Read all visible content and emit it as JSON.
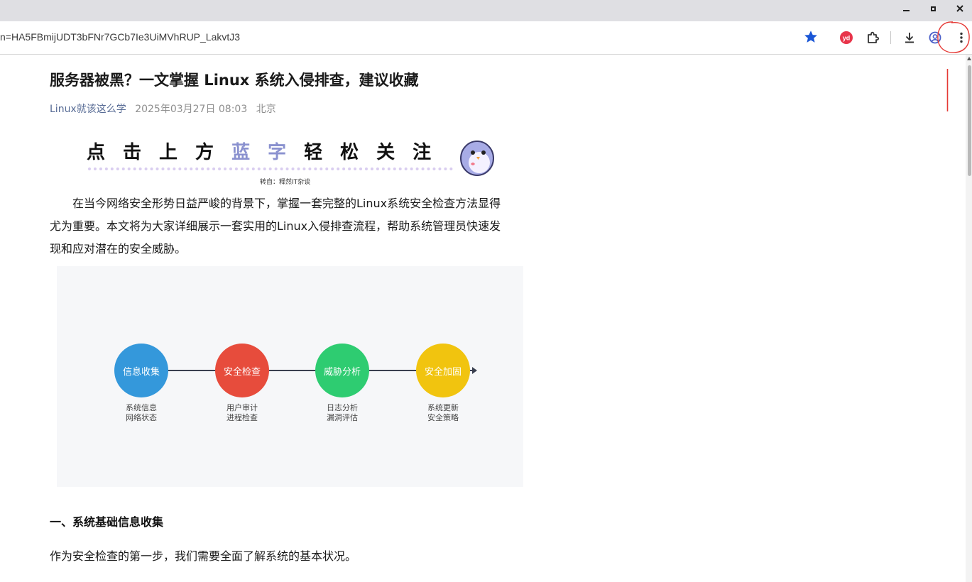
{
  "browser": {
    "url": "n=HA5FBmijUDT3bFNr7GCb7Ie3UiMVhRUP_LakvtJ3",
    "extension_badge": "yd"
  },
  "article": {
    "title": "服务器被黑？一文掌握 Linux 系统入侵排查，建议收藏",
    "author": "Linux就该这么学",
    "date": "2025年03月27日 08:03",
    "location": "北京",
    "banner": {
      "chars": [
        "点",
        "击",
        "上",
        "方",
        "蓝",
        "字",
        "轻",
        "松",
        "关",
        "注"
      ],
      "subtitle": "转自：释然IT杂谈",
      "highlight_color": "#8a91cf"
    },
    "intro_lines": [
      "在当今网络安全形势日益严峻的背景下，掌握一套完整的Linux系统安全检查方法显得",
      "尤为重要。本文将为大家详细展示一套实用的Linux入侵排查流程，帮助系统管理员快速发",
      "现和应对潜在的安全威胁。"
    ],
    "flow": [
      {
        "label": "信息收集",
        "color": "#3498db",
        "desc": [
          "系统信息",
          "网络状态"
        ]
      },
      {
        "label": "安全检查",
        "color": "#e74c3c",
        "desc": [
          "用户审计",
          "进程检查"
        ]
      },
      {
        "label": "威胁分析",
        "color": "#2ecc71",
        "desc": [
          "日志分析",
          "漏洞评估"
        ]
      },
      {
        "label": "安全加固",
        "color": "#f1c40f",
        "desc": [
          "系统更新",
          "安全策略"
        ]
      }
    ],
    "section_heading": "一、系统基础信息收集",
    "section_text": "作为安全检查的第一步，我们需要全面了解系统的基本状况。"
  },
  "icons": {
    "window_minimize": "minimize-icon",
    "window_maximize": "maximize-icon",
    "window_close": "close-icon",
    "bookmark": "star-icon",
    "extension": "puzzle-icon",
    "download": "download-icon",
    "profile": "profile-icon",
    "menu": "kebab-menu-icon"
  }
}
